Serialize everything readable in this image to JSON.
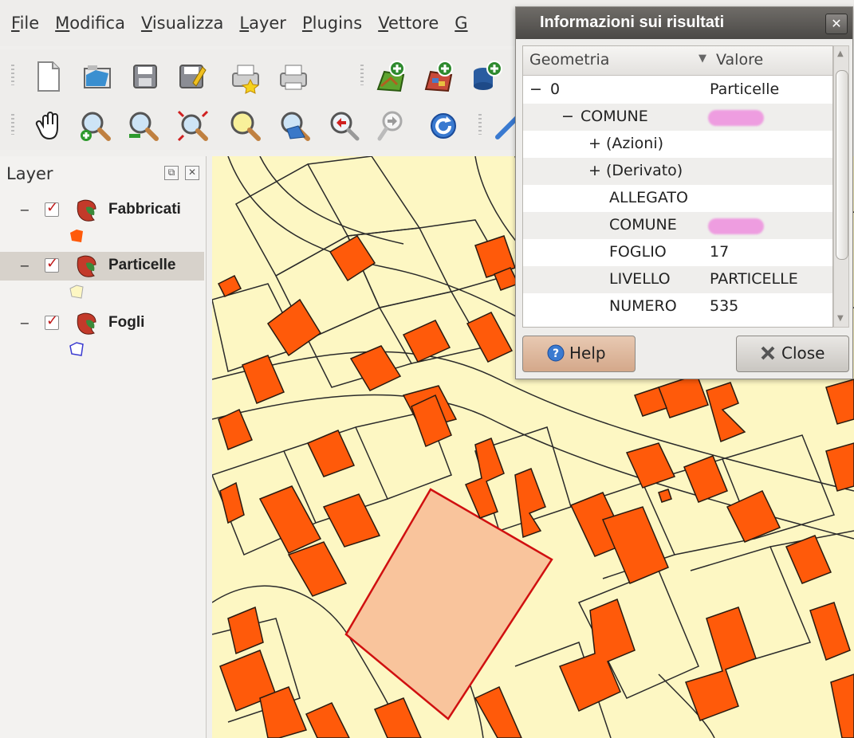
{
  "menu": [
    "File",
    "Modifica",
    "Visualizza",
    "Layer",
    "Plugins",
    "Vettore",
    "G"
  ],
  "layer_panel": {
    "title": "Layer",
    "layers": [
      {
        "name": "Fabbricati",
        "checked": true,
        "legend_color": "#ff5a0a"
      },
      {
        "name": "Particelle",
        "checked": true,
        "selected": true,
        "legend_color": "#fdf7c3"
      },
      {
        "name": "Fogli",
        "checked": true,
        "legend_color": "#ffffff"
      }
    ]
  },
  "dialog": {
    "title": "Informazioni sui risultati",
    "close_glyph": "✕",
    "columns": [
      "Geometria",
      "Valore"
    ],
    "rows": [
      {
        "key": "0",
        "value": "Particelle",
        "toggle": "−"
      },
      {
        "key": "COMUNE",
        "value": "",
        "toggle": "−",
        "redacted": true
      },
      {
        "key": "(Azioni)",
        "value": "",
        "toggle": "+"
      },
      {
        "key": "(Derivato)",
        "value": "",
        "toggle": "+"
      },
      {
        "key": "ALLEGATO",
        "value": ""
      },
      {
        "key": "COMUNE",
        "value": "",
        "redacted": true
      },
      {
        "key": "FOGLIO",
        "value": "17"
      },
      {
        "key": "LIVELLO",
        "value": "PARTICELLE"
      },
      {
        "key": "NUMERO",
        "value": "535"
      }
    ],
    "help_label": "Help",
    "close_label": "Close"
  },
  "colors": {
    "parcel_fill": "#fdf7c3",
    "building_fill": "#ff5a0a",
    "highlight_fill": "#f9c49c",
    "highlight_stroke": "#d01010"
  },
  "icons": {
    "toolbar_row1": [
      "new-project-icon",
      "open-project-icon",
      "save-project-icon",
      "save-as-icon",
      "print-composer-icon",
      "print-icon",
      "add-vector-layer-icon",
      "add-raster-layer-icon",
      "add-postgis-layer-icon"
    ],
    "toolbar_row2": [
      "pan-icon",
      "zoom-in-icon",
      "zoom-out-icon",
      "zoom-full-icon",
      "zoom-selection-icon",
      "zoom-layer-icon",
      "zoom-last-icon",
      "zoom-next-icon",
      "refresh-icon"
    ]
  }
}
